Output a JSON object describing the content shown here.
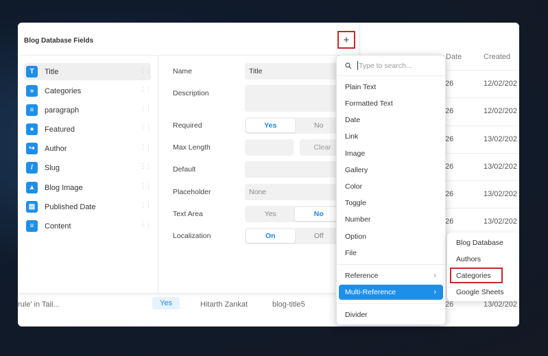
{
  "background_table": {
    "col_date": "Date",
    "col_created": "Created",
    "rows": [
      {
        "date": "26",
        "created": "12/02/202"
      },
      {
        "date": "26",
        "created": "12/02/202"
      },
      {
        "date": "26",
        "created": "13/02/202"
      },
      {
        "date": "26",
        "created": "13/02/202"
      },
      {
        "date": "26",
        "created": "13/02/202"
      },
      {
        "date": "26",
        "created": "13/02/202"
      }
    ],
    "bottom_row": {
      "title": "rule' in Tail...",
      "badge": "Yes",
      "author": "Hitarth Zankat",
      "slug": "blog-title5",
      "date": "26",
      "created": "13/02/202"
    }
  },
  "panel": {
    "title": "Blog Database Fields",
    "fields": [
      {
        "label": "Title",
        "icon": "T"
      },
      {
        "label": "Categories",
        "icon": "»"
      },
      {
        "label": "paragraph",
        "icon": "≡"
      },
      {
        "label": "Featured",
        "icon": "●"
      },
      {
        "label": "Author",
        "icon": "↪"
      },
      {
        "label": "Slug",
        "icon": "/"
      },
      {
        "label": "Blog Image",
        "icon": "▲"
      },
      {
        "label": "Published Date",
        "icon": "▤"
      },
      {
        "label": "Content",
        "icon": "≡"
      }
    ],
    "props": {
      "name_label": "Name",
      "name_value": "Title",
      "description_label": "Description",
      "required_label": "Required",
      "required_yes": "Yes",
      "required_no": "No",
      "maxlength_label": "Max Length",
      "maxlength_clear": "Clear",
      "default_label": "Default",
      "placeholder_label": "Placeholder",
      "placeholder_value": "None",
      "textarea_label": "Text Area",
      "textarea_yes": "Yes",
      "textarea_no": "No",
      "localization_label": "Localization",
      "localization_on": "On",
      "localization_off": "Off"
    }
  },
  "add_button": {
    "label": "+"
  },
  "dropdown": {
    "search_placeholder": "Type to search...",
    "items": [
      "Plain Text",
      "Formatted Text",
      "Date",
      "Link",
      "Image",
      "Gallery",
      "Color",
      "Toggle",
      "Number",
      "Option",
      "File"
    ],
    "reference": "Reference",
    "multi_reference": "Multi-Reference",
    "divider": "Divider"
  },
  "submenu": {
    "items": [
      "Blog Database",
      "Authors",
      "Categories",
      "Google Sheets"
    ]
  },
  "colors": {
    "accent": "#1e8fe8",
    "highlight_border": "#c62828"
  }
}
